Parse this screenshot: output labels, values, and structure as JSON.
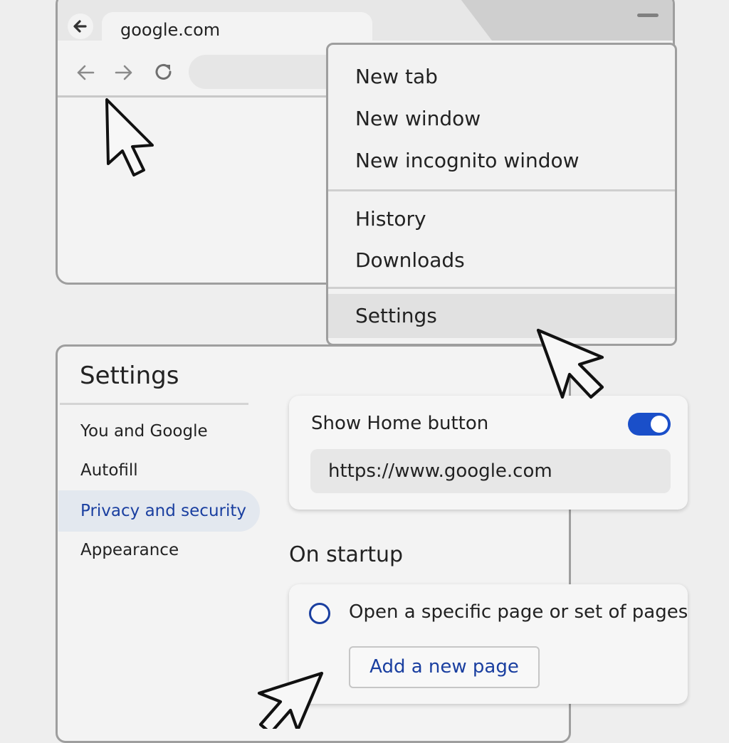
{
  "browser": {
    "tab_title": "google.com",
    "icons": [
      "back-circle-icon",
      "back-arrow-icon",
      "forward-arrow-icon",
      "reload-icon",
      "minimize-icon"
    ]
  },
  "menu": {
    "items": [
      "New tab",
      "New window",
      "New incognito window",
      "History",
      "Downloads",
      "Settings"
    ],
    "highlighted": "Settings"
  },
  "settings": {
    "title": "Settings",
    "sidebar": [
      "You and Google",
      "Autofill",
      "Privacy and security",
      "Appearance"
    ],
    "sidebar_active": "Privacy and security",
    "home_button_label": "Show Home button",
    "home_button_enabled": true,
    "home_url": "https://www.google.com",
    "startup_heading": "On startup",
    "startup_option": "Open a specific page or set of pages",
    "add_page_button": "Add a new page"
  },
  "colors": {
    "accent": "#1a4fc9",
    "link_text": "#1a3fa0",
    "active_nav_bg": "#e3e8ef"
  }
}
